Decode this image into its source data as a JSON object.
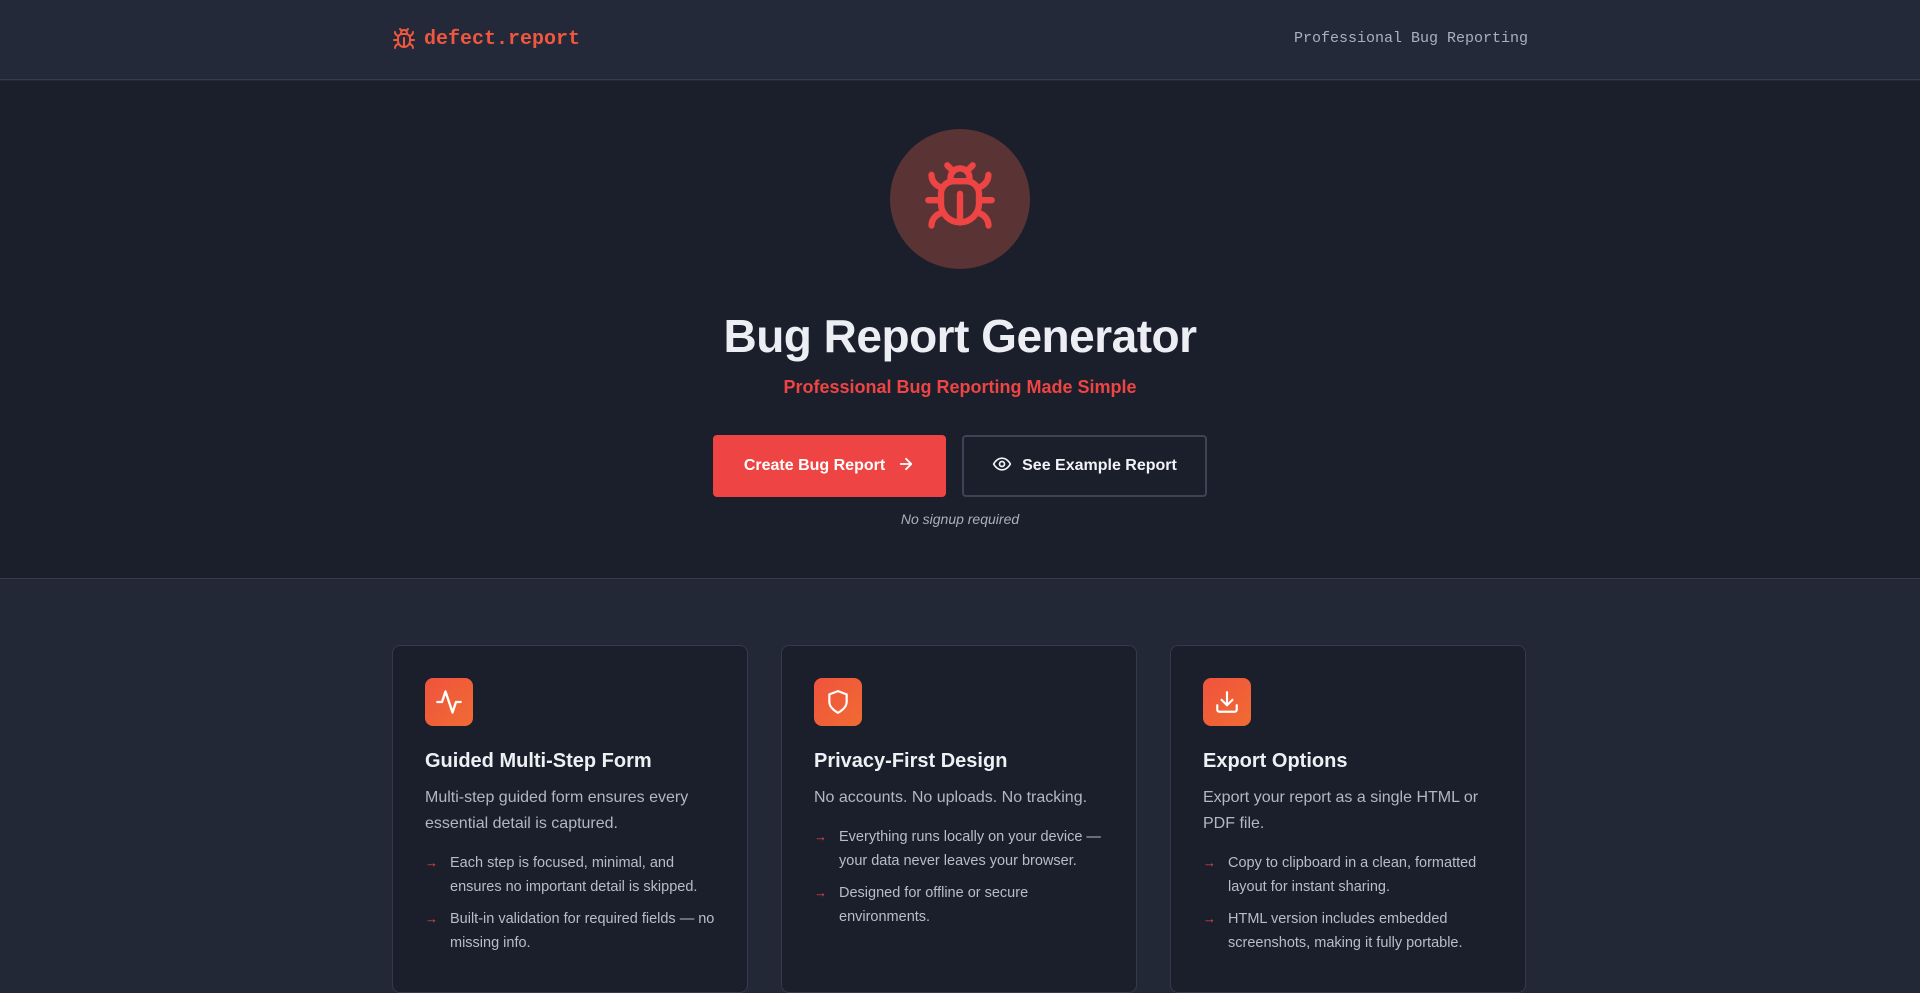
{
  "header": {
    "brand": "defect.report",
    "tagline": "Professional Bug Reporting"
  },
  "hero": {
    "icon": "bug-icon",
    "title": "Bug Report Generator",
    "subtitle": "Professional Bug Reporting Made Simple",
    "primary_button": "Create Bug Report",
    "secondary_button": "See Example Report",
    "note": "No signup required"
  },
  "colors": {
    "accent": "#ef4444",
    "brand": "#f0573e",
    "hero_bg": "#1b1f2b",
    "page_bg": "#222836"
  },
  "features": [
    {
      "icon": "activity-icon",
      "title": "Guided Multi-Step Form",
      "description": "Multi-step guided form ensures every essential detail is captured.",
      "points": [
        "Each step is focused, minimal, and ensures no important detail is skipped.",
        "Built-in validation for required fields — no missing info."
      ]
    },
    {
      "icon": "shield-icon",
      "title": "Privacy-First Design",
      "description": "No accounts. No uploads. No tracking.",
      "points": [
        "Everything runs locally on your device — your data never leaves your browser.",
        "Designed for offline or secure environments."
      ]
    },
    {
      "icon": "download-icon",
      "title": "Export Options",
      "description": "Export your report as a single HTML or PDF file.",
      "points": [
        "Copy to clipboard in a clean, formatted layout for instant sharing.",
        "HTML version includes embedded screenshots, making it fully portable."
      ]
    }
  ]
}
